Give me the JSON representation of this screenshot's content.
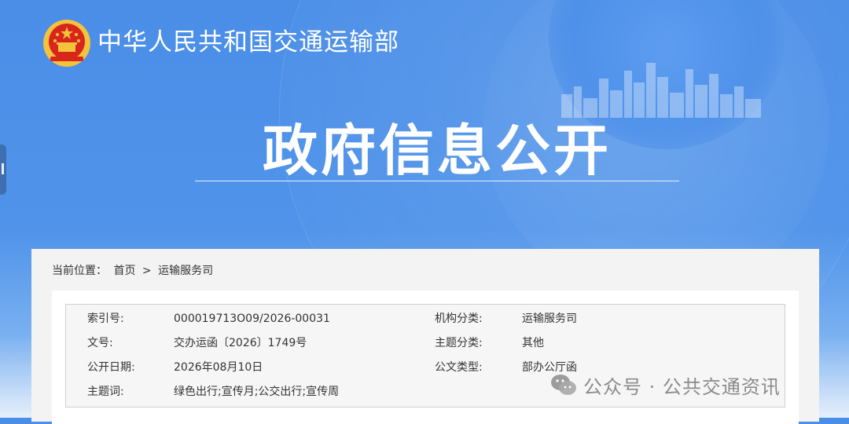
{
  "header": {
    "ministry_name": "中华人民共和国交通运输部",
    "main_title": "政府信息公开"
  },
  "icons": {
    "emblem": "national-emblem-icon",
    "wechat": "wechat-icon"
  },
  "breadcrumb": {
    "prefix": "当前位置：",
    "home": "首页",
    "separator": ">",
    "current": "运输服务司"
  },
  "info": {
    "rows": [
      {
        "label1": "索引号:",
        "value1": "000019713O09/2026-00031",
        "label2": "机构分类:",
        "value2": "运输服务司"
      },
      {
        "label1": "文号:",
        "value1": "交办运函〔2026〕1749号",
        "label2": "主题分类:",
        "value2": "其他"
      },
      {
        "label1": "公开日期:",
        "value1": "2026年08月10日",
        "label2": "公文类型:",
        "value2": "部办公厅函"
      },
      {
        "label1": "主题词:",
        "value1": "绿色出行;宣传月;公交出行;宣传周",
        "label2": "",
        "value2": ""
      }
    ]
  },
  "watermark": {
    "text": "公众号 · 公共交通资讯"
  },
  "colors": {
    "banner_blue": "#4a8ee8",
    "emblem_red": "#d8261c",
    "emblem_gold": "#f3c33b"
  }
}
